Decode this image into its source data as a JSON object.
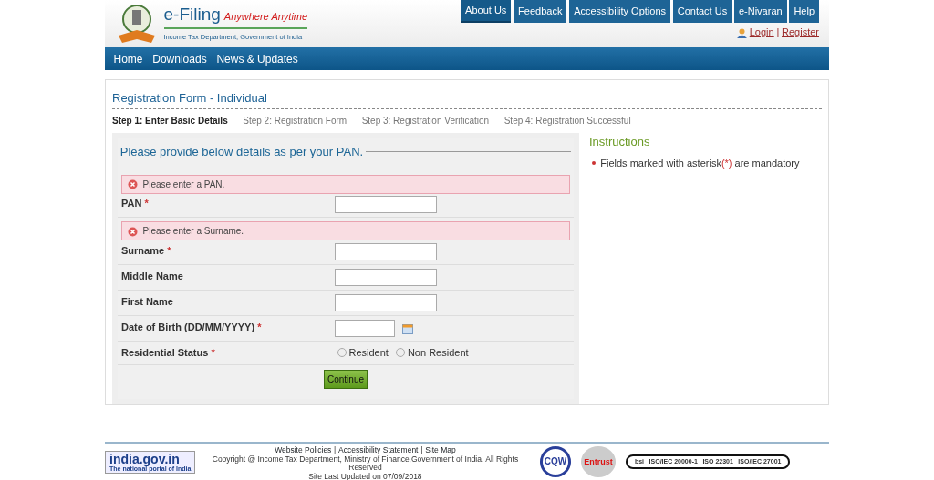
{
  "header": {
    "brand": "e-Filing",
    "tagline": "Anywhere Anytime",
    "subtitle": "Income Tax Department, Government of India"
  },
  "top_links": [
    {
      "label": "About Us",
      "selected": true
    },
    {
      "label": "Feedback",
      "selected": false
    },
    {
      "label": "Accessibility Options",
      "selected": false
    },
    {
      "label": "Contact Us",
      "selected": false
    },
    {
      "label": "e-Nivaran",
      "selected": false
    },
    {
      "label": "Help",
      "selected": false
    }
  ],
  "account": {
    "login": "Login",
    "separator": "|",
    "register": "Register"
  },
  "nav": [
    "Home",
    "Downloads",
    "News & Updates"
  ],
  "page_title": "Registration Form - Individual",
  "steps": [
    {
      "label": "Step 1: Enter Basic Details",
      "selected": true
    },
    {
      "label": "Step 2: Registration Form",
      "selected": false
    },
    {
      "label": "Step 3: Registration Verification",
      "selected": false
    },
    {
      "label": "Step 4: Registration Successful",
      "selected": false
    }
  ],
  "form": {
    "legend": "Please provide below details as per your PAN.",
    "fields": [
      {
        "kind": "text",
        "label": "PAN",
        "required_mark": "*",
        "error": "Please enter a PAN."
      },
      {
        "kind": "text",
        "label": "Surname",
        "required_mark": "*",
        "error": "Please enter a Surname."
      },
      {
        "kind": "text",
        "label": "Middle Name"
      },
      {
        "kind": "text",
        "label": "First Name"
      },
      {
        "kind": "date",
        "label": "Date of Birth (DD/MM/YYYY)",
        "required_mark": "*"
      },
      {
        "kind": "radio",
        "label": "Residential Status",
        "required_mark": "*",
        "options": [
          {
            "label": "Resident",
            "selected": false
          },
          {
            "label": "Non Resident",
            "selected": false
          }
        ]
      }
    ],
    "submit": "Continue"
  },
  "instructions": {
    "title": "Instructions",
    "items": [
      {
        "before": "Fields marked with asterisk",
        "mark": "(*)",
        "after": "are mandatory"
      }
    ]
  },
  "footer": {
    "links": [
      "Website Policies",
      "Accessibility Statement",
      "Site Map"
    ],
    "link_separator": "|",
    "copyright": "Copyright @ Income Tax Department, Ministry of Finance,Government of India. All Rights Reserved",
    "updated": "Site Last Updated on 07/09/2018",
    "portal": {
      "name": "india.gov.in",
      "caption": "The national portal of India"
    },
    "badges": [
      {
        "kind": "cqw",
        "text": "CQW"
      },
      {
        "kind": "entrust",
        "text": "Entrust"
      },
      {
        "kind": "bsi",
        "text": "bsi"
      }
    ],
    "certs": [
      "ISO/IEC 20000-1",
      "ISO 22301",
      "ISO/IEC 27001"
    ]
  }
}
